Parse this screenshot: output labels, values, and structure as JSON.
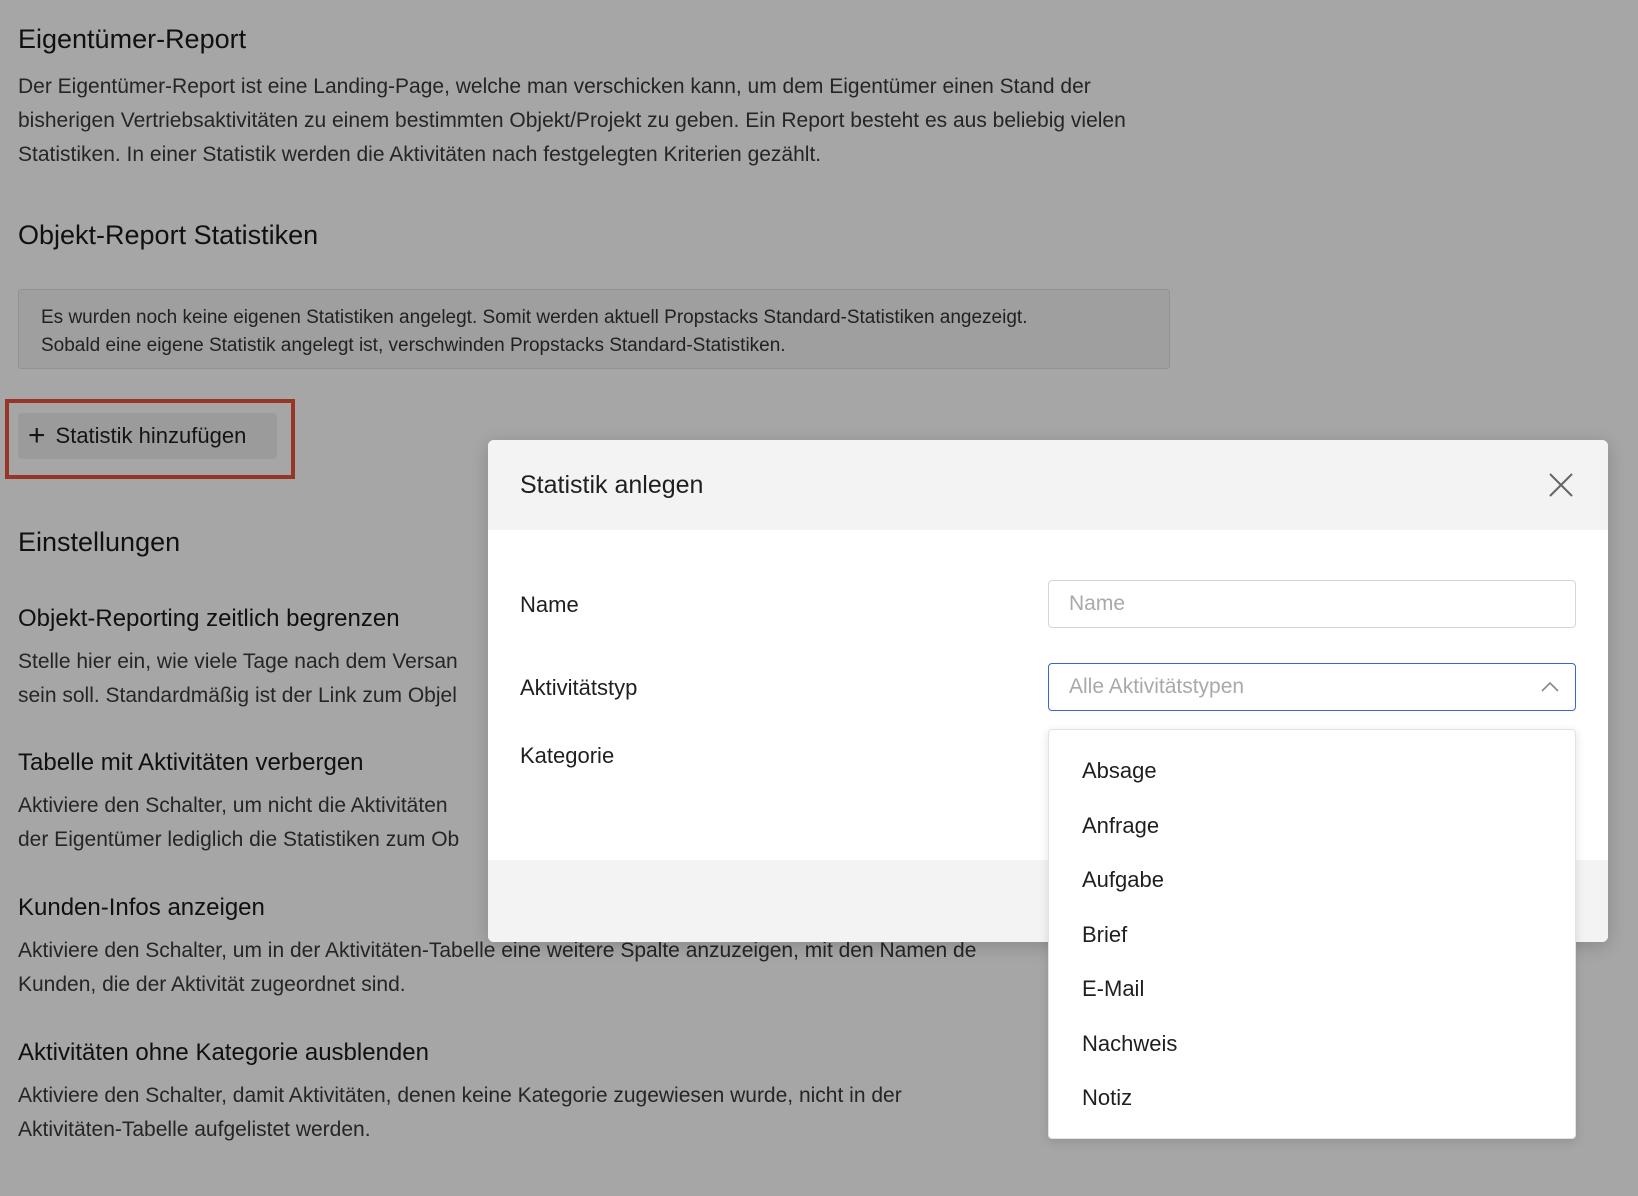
{
  "page": {
    "title": "Eigentümer-Report",
    "intro": "Der Eigentümer-Report ist eine Landing-Page, welche man verschicken kann, um dem Eigentümer einen Stand der bisherigen Vertriebsaktivitäten zu einem bestimmten Objekt/Projekt zu geben. Ein Report besteht es aus beliebig vielen Statistiken. In einer Statistik werden die Aktivitäten nach festgelegten Kriterien gezählt.",
    "stats_heading": "Objekt-Report Statistiken",
    "info_line1": "Es wurden noch keine eigenen Statistiken angelegt. Somit werden aktuell Propstacks Standard-Statistiken angezeigt.",
    "info_line2": "Sobald eine eigene Statistik angelegt ist, verschwinden Propstacks Standard-Statistiken.",
    "add_button_label": "Statistik hinzufügen",
    "settings_heading": "Einstellungen",
    "settings": [
      {
        "title": "Objekt-Reporting zeitlich begrenzen",
        "line1": "Stelle hier ein, wie viele Tage nach dem Versan",
        "line2": "sein soll. Standardmäßig ist der Link zum Objel"
      },
      {
        "title": "Tabelle mit Aktivitäten verbergen",
        "line1": "Aktiviere den Schalter, um nicht die Aktivitäten",
        "line2": "der Eigentümer lediglich die Statistiken zum Ob"
      },
      {
        "title": "Kunden-Infos anzeigen",
        "line1": "Aktiviere den Schalter, um in der Aktivitäten-Tabelle eine weitere Spalte anzuzeigen, mit den Namen de",
        "line2": "Kunden, die der Aktivität zugeordnet sind."
      },
      {
        "title": "Aktivitäten ohne Kategorie ausblenden",
        "line1": "Aktiviere den Schalter, damit Aktivitäten, denen keine Kategorie zugewiesen wurde, nicht in der",
        "line2": "Aktivitäten-Tabelle aufgelistet werden."
      }
    ]
  },
  "modal": {
    "title": "Statistik anlegen",
    "name_label": "Name",
    "name_placeholder": "Name",
    "activity_type_label": "Aktivitätstyp",
    "activity_type_placeholder": "Alle Aktivitätstypen",
    "category_label": "Kategorie",
    "dropdown_options": [
      "Absage",
      "Anfrage",
      "Aufgabe",
      "Brief",
      "E-Mail",
      "Nachweis",
      "Notiz"
    ]
  },
  "colors": {
    "highlight_outline": "#e5533b",
    "select_focus_border": "#3d63d6",
    "overlay": "rgba(0,0,0,0.35)"
  }
}
